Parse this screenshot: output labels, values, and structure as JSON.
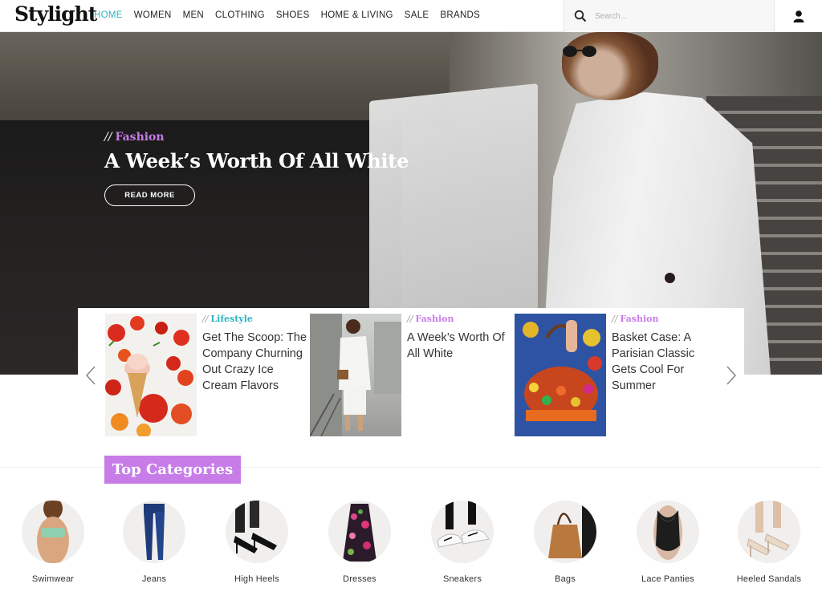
{
  "header": {
    "logo": "Stylight",
    "nav": [
      "HOME",
      "WOMEN",
      "MEN",
      "CLOTHING",
      "SHOES",
      "HOME & LIVING",
      "SALE",
      "BRANDS"
    ],
    "active_nav": "HOME",
    "search_placeholder": "Search..."
  },
  "hero": {
    "category_prefix": "//",
    "category": "Fashion",
    "title": "A Week’s Worth Of All White",
    "button": "READ MORE"
  },
  "carousel": {
    "cards": [
      {
        "prefix": "//",
        "category": "Lifestyle",
        "category_color": "#2bb5c0",
        "title": "Get The Scoop: The Company Churning Out Crazy Ice Cream Flavors"
      },
      {
        "prefix": "//",
        "category": "Fashion",
        "category_color": "#c77ce8",
        "title": "A Week’s Worth Of All White"
      },
      {
        "prefix": "//",
        "category": "Fashion",
        "category_color": "#c77ce8",
        "title": "Basket Case: A Parisian Classic Gets Cool For Summer"
      }
    ]
  },
  "top_categories": {
    "label": "Top Categories",
    "items": [
      "Swimwear",
      "Jeans",
      "High Heels",
      "Dresses",
      "Sneakers",
      "Bags",
      "Lace Panties",
      "Heeled Sandals"
    ]
  },
  "colors": {
    "accent_teal": "#2bb5c0",
    "accent_purple": "#c77ce8"
  }
}
